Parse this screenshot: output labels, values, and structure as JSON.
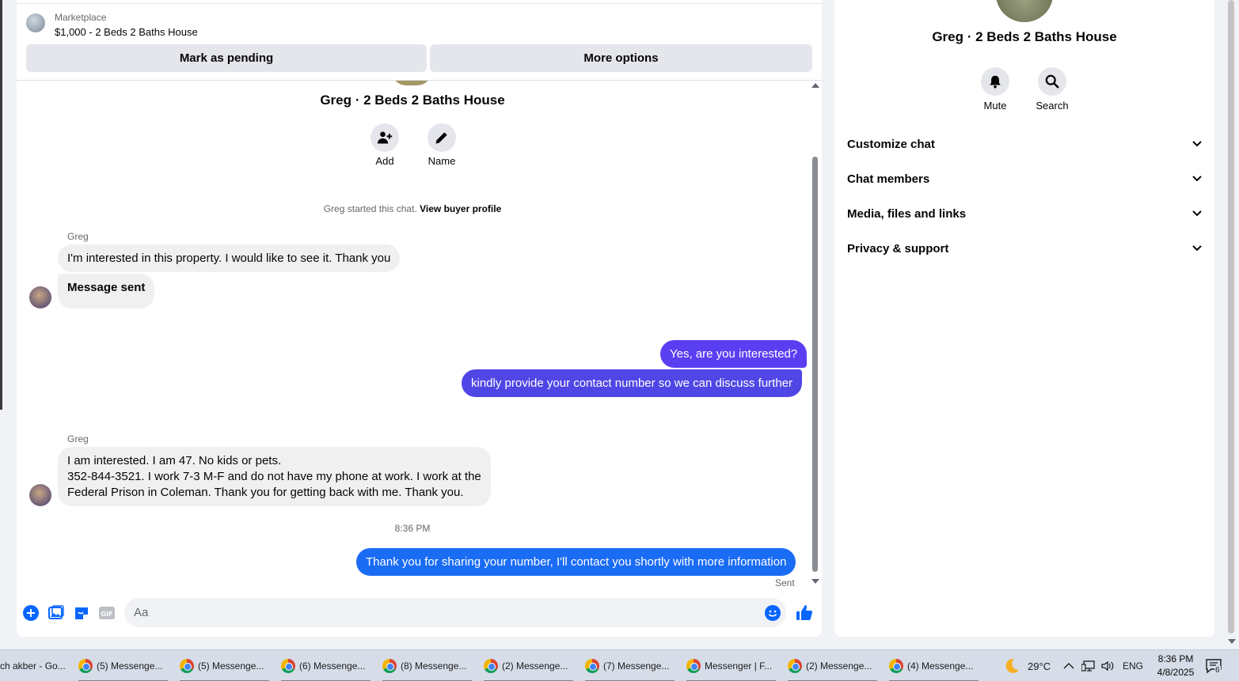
{
  "marketplace": {
    "label": "Marketplace",
    "listing_title": "$1,000 - 2 Beds 2 Baths House",
    "mark_pending": "Mark as pending",
    "more_options": "More options"
  },
  "chat": {
    "title": "Greg · 2 Beds 2 Baths House",
    "add_label": "Add",
    "name_label": "Name",
    "system_message": "Greg started this chat.",
    "view_profile": "View buyer profile",
    "messages": [
      {
        "direction": "in",
        "sender": "Greg",
        "text": "I'm interested in this property. I would like to see it. Thank you"
      },
      {
        "direction": "in",
        "text": "Message sent"
      },
      {
        "direction": "out",
        "text": "Yes, are you interested?"
      },
      {
        "direction": "out",
        "text": "kindly provide your contact number so we can discuss further"
      },
      {
        "direction": "in",
        "sender": "Greg",
        "lines": [
          "I am interested. I am 47. No kids or pets.",
          "352-844-3521. I work 7-3 M-F and do not have my phone at work.   I work at the",
          "Federal Prison in Coleman. Thank you for getting back with me. Thank you."
        ]
      },
      {
        "direction": "out",
        "text": "Thank you for sharing your number, I'll contact you shortly with more information"
      }
    ],
    "timestamp": "8:36 PM",
    "sent_status": "Sent",
    "composer_placeholder": "Aa",
    "outgoing_colors": [
      "#5a3ff2",
      "#4f46e5",
      "#1a6cf5"
    ],
    "accent": "#0866ff"
  },
  "info": {
    "title": "Greg · 2 Beds 2 Baths House",
    "mute_label": "Mute",
    "search_label": "Search",
    "sections": [
      "Customize chat",
      "Chat members",
      "Media, files and links",
      "Privacy & support"
    ]
  },
  "taskbar": {
    "items": [
      "ch akber - Go...",
      "(5) Messenge...",
      "(5) Messenge...",
      "(6) Messenge...",
      "(8) Messenge...",
      "(2) Messenge...",
      "(7) Messenge...",
      "Messenger | F...",
      "(2) Messenge...",
      "(4) Messenge..."
    ],
    "weather": "29°C",
    "language": "ENG",
    "time": "8:36 PM",
    "date": "4/8/2025",
    "notification_count": "6"
  }
}
